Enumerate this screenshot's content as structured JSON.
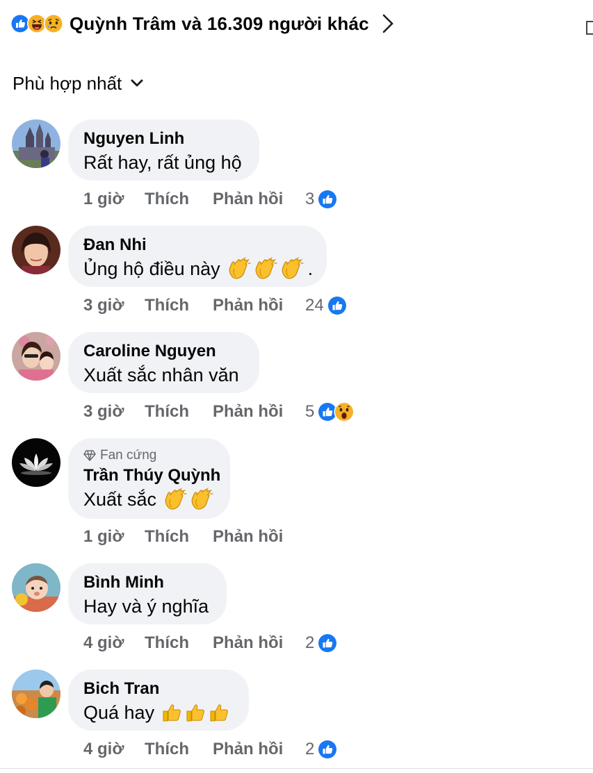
{
  "header": {
    "reactors_text": "Quỳnh Trâm và 16.309 người khác",
    "reaction_icons": [
      "like-icon",
      "haha-icon",
      "sad-icon"
    ]
  },
  "sort": {
    "label": "Phù hợp nhất"
  },
  "actions": {
    "like_label": "Thích",
    "reply_label": "Phản hồi"
  },
  "comments": [
    {
      "author": "Nguyen Linh",
      "text": "Rất hay, rất ủng hộ",
      "time": "1 giờ",
      "reaction_count": "3",
      "emojis": []
    },
    {
      "author": "Đan Nhi",
      "text": "Ủng hộ điều này",
      "text_tail": ".",
      "time": "3 giờ",
      "reaction_count": "24",
      "emojis": [
        "clap-emoji",
        "clap-emoji",
        "clap-emoji"
      ]
    },
    {
      "author": "Caroline Nguyen",
      "text": "Xuất sắc nhân văn",
      "time": "3 giờ",
      "reaction_count": "5",
      "emojis": []
    },
    {
      "author": "Trần Thúy Quỳnh",
      "badge": "Fan cứng",
      "text": "Xuất sắc",
      "time": "1 giờ",
      "reaction_count": "",
      "emojis": [
        "clap-emoji",
        "clap-emoji"
      ]
    },
    {
      "author": "Bình Minh",
      "text": "Hay và ý nghĩa",
      "time": "4 giờ",
      "reaction_count": "2",
      "emojis": []
    },
    {
      "author": "Bich Tran",
      "text": "Quá hay",
      "time": "4 giờ",
      "reaction_count": "2",
      "emojis": [
        "thumbs-up-emoji",
        "thumbs-up-emoji",
        "thumbs-up-emoji"
      ]
    }
  ],
  "colors": {
    "like_blue": "#1877f2",
    "bubble_bg": "#f0f2f5",
    "secondary_text": "#65676b"
  }
}
